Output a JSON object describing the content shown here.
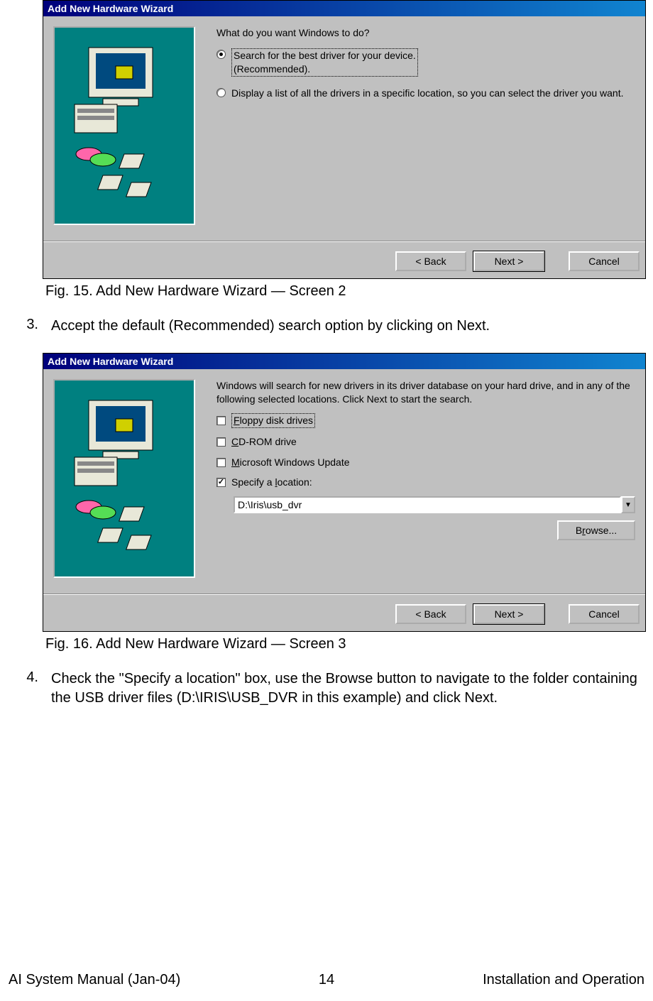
{
  "dialog1": {
    "title": "Add New Hardware Wizard",
    "prompt": "What do you want Windows to do?",
    "option1_line1": "Search for the best driver for your device.",
    "option1_line2": "(Recommended).",
    "option2": "Display a list of all the drivers in a specific location, so you can select the driver you want.",
    "back": "< Back",
    "next": "Next >",
    "cancel": "Cancel"
  },
  "caption1": "Fig. 15.  Add New Hardware Wizard — Screen 2",
  "step3_num": "3.",
  "step3_text": "Accept the default (Recommended) search option by clicking on Next.",
  "dialog2": {
    "title": "Add New Hardware Wizard",
    "intro": "Windows will search for new drivers in its driver database on your hard drive, and in any of the following selected locations. Click Next to start the search.",
    "chk_floppy_pre": "F",
    "chk_floppy_rest": "loppy disk drives",
    "chk_cd_pre": "C",
    "chk_cd_rest": "D-ROM drive",
    "chk_mwu_pre": "M",
    "chk_mwu_rest": "icrosoft Windows Update",
    "chk_loc_pre": "Specify a ",
    "chk_loc_u": "l",
    "chk_loc_rest": "ocation:",
    "path": "D:\\Iris\\usb_dvr",
    "browse_pre": "B",
    "browse_u": "r",
    "browse_rest": "owse...",
    "back": "< Back",
    "next": "Next >",
    "cancel": "Cancel"
  },
  "caption2": "Fig. 16.  Add New Hardware Wizard — Screen 3",
  "step4_num": "4.",
  "step4_text": "Check the \"Specify a location\" box, use the Browse button to navigate to the folder containing the USB driver files (D:\\IRIS\\USB_DVR in this example) and click Next.",
  "footer_left": "AI System Manual (Jan-04)",
  "footer_page": "14",
  "footer_right": "Installation and Operation"
}
